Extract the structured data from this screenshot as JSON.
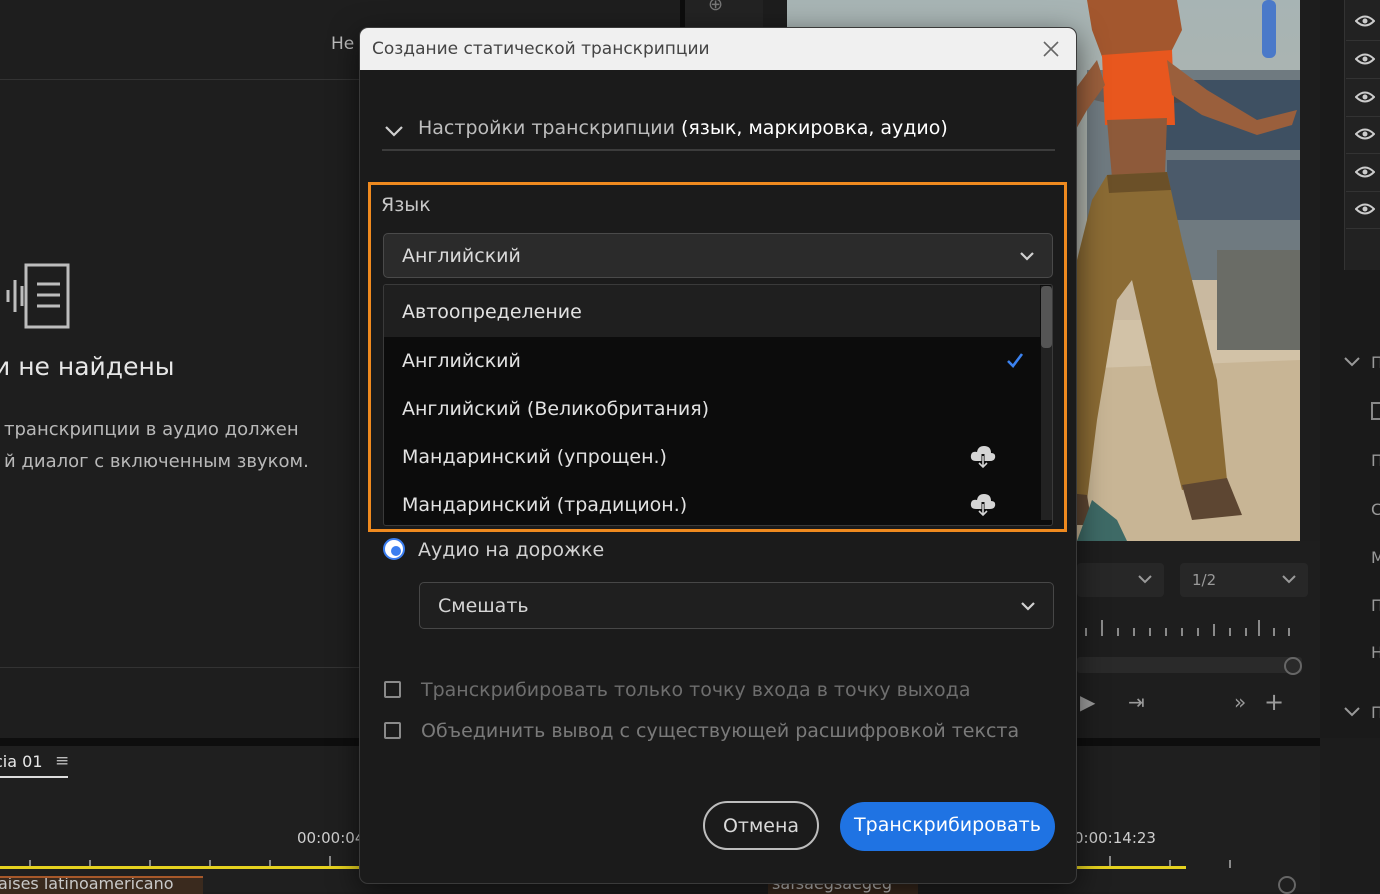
{
  "background": {
    "left_panel": {
      "header_text": "Не",
      "title": "и не найдены",
      "description_line1": "транскрипции в аудио должен",
      "description_line2": "й диалог с включенным звуком."
    },
    "program_monitor": {
      "resolution": "1/2"
    },
    "timeline": {
      "sequence_tab": "cia 01",
      "timecode_left": "00:00:04",
      "timecode_right": "0:00:14:23",
      "clip1": "aíses latinoamericano",
      "clip2": "safsaegsaegeg"
    },
    "right_strip": {
      "letters": [
        "П",
        "П",
        "С",
        "М",
        "П",
        "Н",
        "П"
      ]
    }
  },
  "dialog": {
    "title": "Создание статической транскрипции",
    "settings_section": {
      "label": "Настройки транскрипции",
      "label_detail": "(язык, маркировка, аудио)"
    },
    "language": {
      "label": "Язык",
      "selected": "Английский",
      "options": [
        {
          "label": "Автоопределение",
          "icon": ""
        },
        {
          "label": "Английский",
          "icon": "checkmark-icon"
        },
        {
          "label": "Английский (Великобритания)",
          "icon": ""
        },
        {
          "label": "Мандаринский (упрощен.)",
          "icon": "cloud-download-icon"
        },
        {
          "label": "Мандаринский (традицион.)",
          "icon": "cloud-download-icon"
        }
      ]
    },
    "audio": {
      "radio_label": "Аудио на дорожке",
      "mix_value": "Смешать"
    },
    "options": {
      "inout_label": "Транскрибировать только точку входа в точку выхода",
      "merge_label": "Объединить вывод с существующей расшифровкой текста"
    },
    "buttons": {
      "cancel": "Отмена",
      "transcribe": "Транскрибировать"
    }
  },
  "colors": {
    "highlight": "#ef8a1f",
    "accent": "#1f73e3"
  }
}
